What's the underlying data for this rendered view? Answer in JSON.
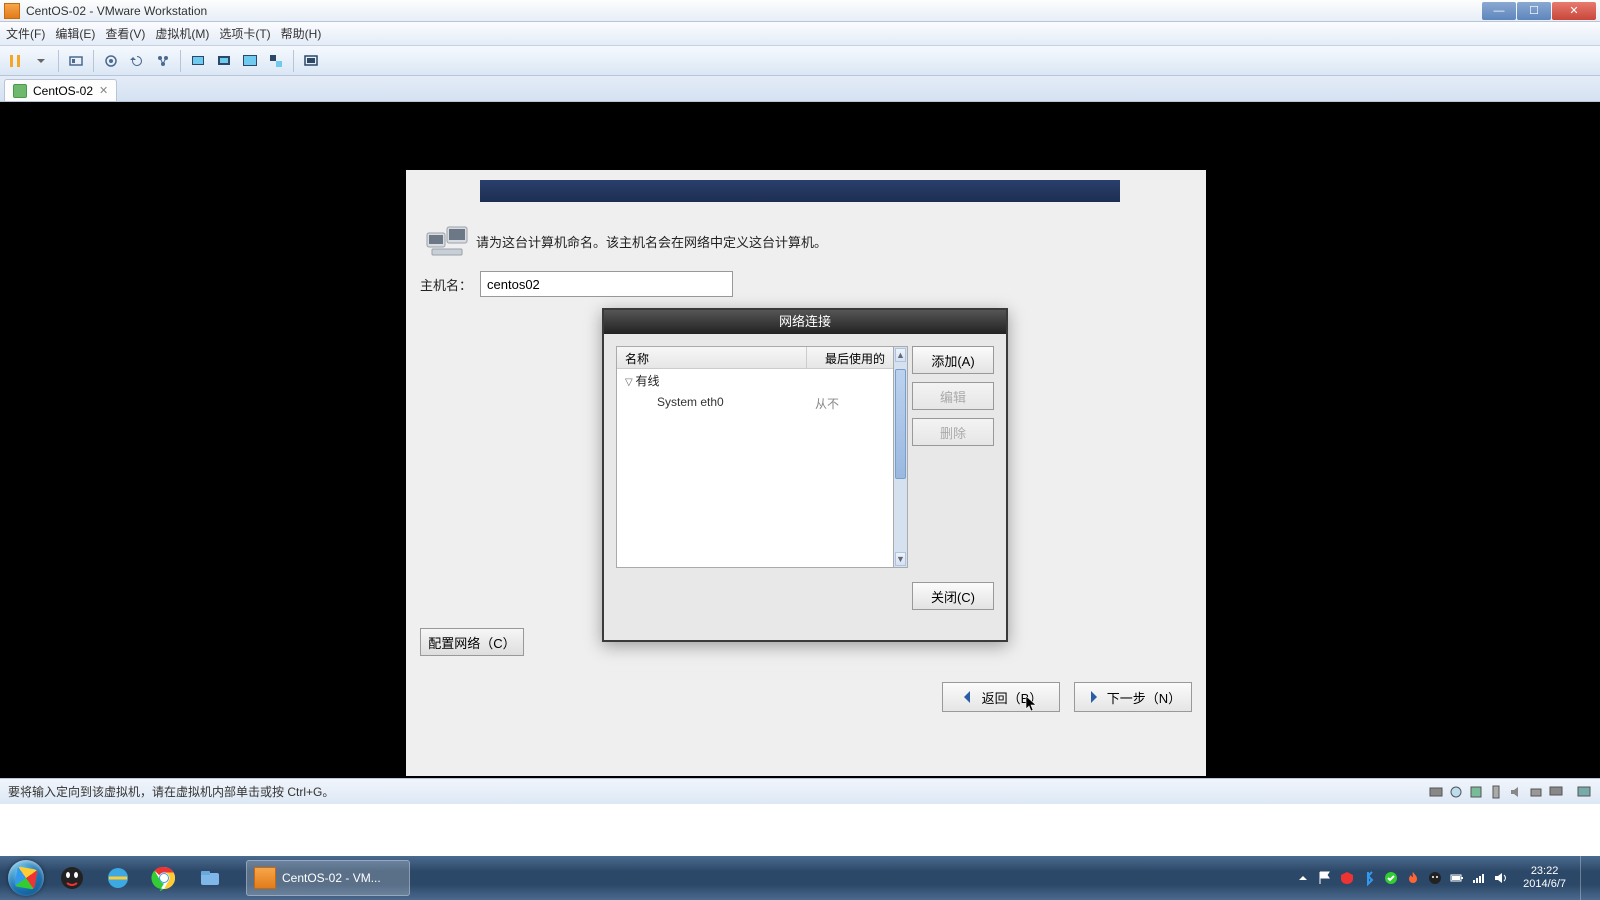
{
  "window": {
    "title": "CentOS-02 - VMware Workstation"
  },
  "menubar": {
    "file": "文件(F)",
    "edit": "编辑(E)",
    "view": "查看(V)",
    "vm": "虚拟机(M)",
    "tabs": "选项卡(T)",
    "help": "帮助(H)"
  },
  "tab": {
    "label": "CentOS-02"
  },
  "centos": {
    "instruction": "请为这台计算机命名。该主机名会在网络中定义这台计算机。",
    "hostname_label": "主机名：",
    "hostname_value": "centos02",
    "config_network_btn": "配置网络（C）",
    "back_btn": "返回（B）",
    "next_btn": "下一步（N）"
  },
  "net_dialog": {
    "title": "网络连接",
    "col_name": "名称",
    "col_last": "最后使用的",
    "group_wired": "有线",
    "item_name": "System eth0",
    "item_last": "从不",
    "add_btn": "添加(A)",
    "edit_btn": "编辑",
    "delete_btn": "删除",
    "close_btn": "关闭(C)"
  },
  "statusbar": {
    "hint": "要将输入定向到该虚拟机，请在虚拟机内部单击或按 Ctrl+G。"
  },
  "taskbar": {
    "running_label": "CentOS-02 - VM..."
  },
  "clock": {
    "time": "23:22",
    "date": "2014/6/7"
  },
  "icons": {
    "pause": "pause",
    "snapshot": "snapshot",
    "revert": "revert",
    "manage": "manage",
    "settings": "settings",
    "fit": "fit",
    "full": "full",
    "unity": "unity",
    "console": "console",
    "thumb": "thumb",
    "cycle": "cycle"
  }
}
